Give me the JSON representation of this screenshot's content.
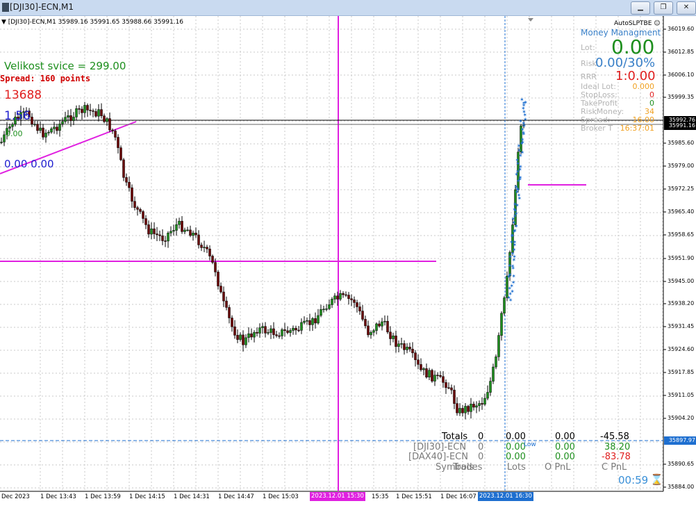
{
  "window": {
    "title": "[DJI30]-ECN,M1"
  },
  "chart": {
    "info_line": "▼ [DJI30]-ECN,M1  35989.16 35991.65 35988.66 35991.16",
    "velikost": "Velikost svice = 299.00",
    "spread": "Spread: 160 points",
    "v13688": "13688",
    "v156": "1.56",
    "v00": "0.00",
    "v0000": "0.00 0.00"
  },
  "money_management": {
    "ea_name": "AutoSLPTBE ☺",
    "title": "Money Managment",
    "lot_label": "Lot:",
    "lot_value": "0.00",
    "risk_label": "Risk",
    "risk_value": "0.00/30%",
    "rrr_label": "RRR",
    "rrr_value": "1:0.00",
    "rows": [
      {
        "label": "Ideal Lot:",
        "value": "0.000",
        "color": "#f0a020"
      },
      {
        "label": "StopLoss:",
        "value": "0",
        "color": "#e02020"
      },
      {
        "label": "TakeProfit",
        "value": "0",
        "color": "#1e8f1e"
      },
      {
        "label": "RiskMoney:",
        "value": "34",
        "color": "#f0a020"
      },
      {
        "label": "Spread:",
        "value": "16.00",
        "color": "#f0a020"
      },
      {
        "label": "Broker T",
        "value": "16:37:01",
        "color": "#f0a020"
      }
    ]
  },
  "totals_table": {
    "totals_label": "Totals",
    "totals_trades": "0",
    "totals_lots": "0.00",
    "totals_opnl": "0.00",
    "totals_cpnl": "-45.58",
    "row1_symbol": "[DJI30]-ECN",
    "row1_trades": "0",
    "row1_lots": "0.00",
    "row1_opnl": "0.00",
    "row1_cpnl": "38.20",
    "row2_symbol": "[DAX40]-ECN",
    "row2_trades": "0",
    "row2_lots": "0.00",
    "row2_opnl": "0.00",
    "row2_cpnl": "-83.78",
    "hdr_symbols": "Symbols",
    "hdr_trades": "Trades",
    "hdr_lots": "Lots",
    "hdr_opnl": "O PnL",
    "hdr_cpnl": "C PnL",
    "overlay_text": "Low",
    "timer": "00:59",
    "timer_icon": "hourglass-icon"
  },
  "price_axis": {
    "labels": [
      "36019.60",
      "36012.85",
      "36006.10",
      "35999.35",
      "35985.60",
      "35979.00",
      "35972.25",
      "35965.40",
      "35958.65",
      "35951.90",
      "35945.00",
      "35938.20",
      "35931.45",
      "35924.60",
      "35917.85",
      "35911.05",
      "35904.20",
      "35890.65",
      "35884.00"
    ],
    "tag_upper": "35992.76",
    "tag_lower": "35991.16",
    "tag_blue": "35897.97"
  },
  "time_axis": {
    "labels": [
      "Dec 2023",
      "1 Dec 13:43",
      "1 Dec 13:59",
      "1 Dec 14:15",
      "1 Dec 14:31",
      "1 Dec 14:47",
      "1 Dec 15:03",
      "15:35",
      "1 Dec 15:51",
      "1 Dec 16:07"
    ],
    "tag_magenta": "2023.12.01 15:30",
    "tag_blue": "2023.12.01 16:30"
  },
  "colors": {
    "magenta": "#e020e0",
    "blue": "#1e6fd0",
    "bull": "#1e8f1e",
    "bear": "#6b0000"
  }
}
